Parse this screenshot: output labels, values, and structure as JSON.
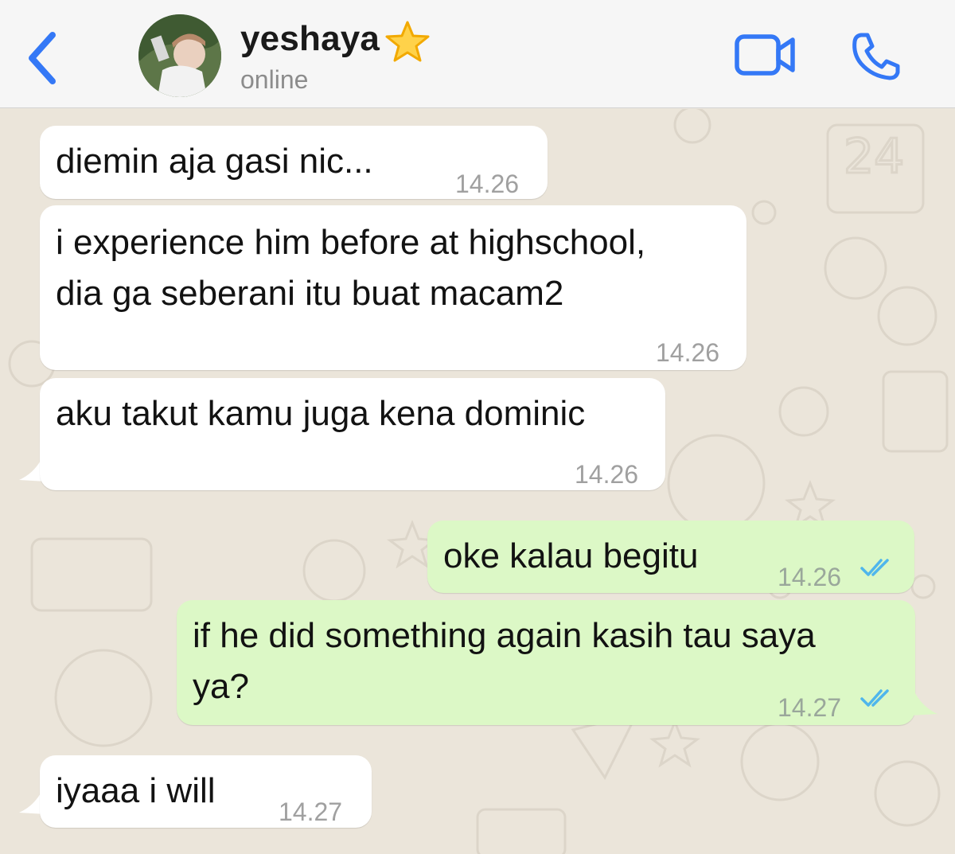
{
  "header": {
    "contact_name": "yeshaya",
    "status": "online",
    "accent_color": "#3478f6"
  },
  "icons": {
    "back": "chevron-left-icon",
    "name_badge": "star-icon",
    "video": "video-camera-icon",
    "call": "phone-icon",
    "read_receipt": "double-check-icon"
  },
  "messages": [
    {
      "direction": "in",
      "lines": [
        "diemin aja gasi nic..."
      ],
      "time": "14.26"
    },
    {
      "direction": "in",
      "lines": [
        "i experience him before at highschool,",
        "dia ga seberani itu buat macam2"
      ],
      "time": "14.26"
    },
    {
      "direction": "in",
      "lines": [
        "aku takut kamu juga kena dominic"
      ],
      "time": "14.26"
    },
    {
      "direction": "out",
      "lines": [
        "oke kalau begitu"
      ],
      "time": "14.26",
      "read": true
    },
    {
      "direction": "out",
      "lines": [
        "if he did something again kasih tau saya",
        "ya?"
      ],
      "time": "14.27",
      "read": true
    },
    {
      "direction": "in",
      "lines": [
        "iyaaa i will"
      ],
      "time": "14.27"
    }
  ],
  "colors": {
    "incoming_bubble": "#ffffff",
    "outgoing_bubble": "#dcf8c6",
    "read_check": "#4fb6ec",
    "wallpaper": "#ebe5da"
  }
}
